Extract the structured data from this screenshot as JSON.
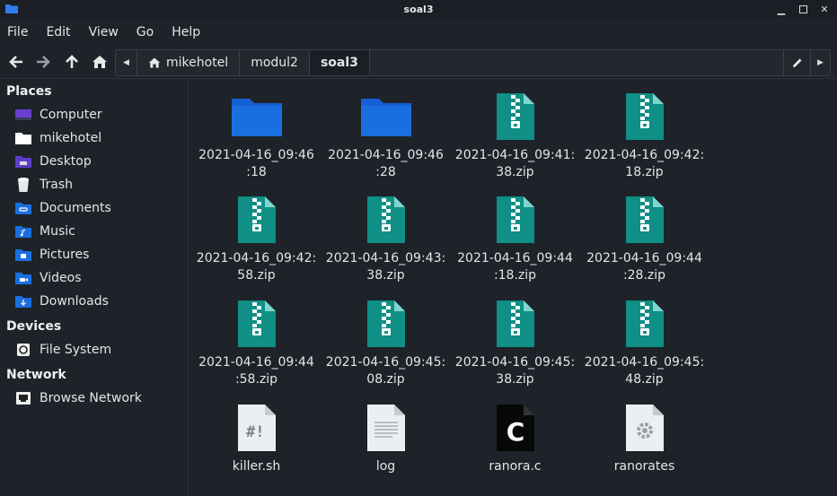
{
  "window": {
    "title": "soal3"
  },
  "menu": [
    "File",
    "Edit",
    "View",
    "Go",
    "Help"
  ],
  "breadcrumbs": [
    {
      "label": "mikehotel",
      "home": true
    },
    {
      "label": "modul2",
      "home": false
    },
    {
      "label": "soal3",
      "home": false
    }
  ],
  "sidebar": {
    "places_title": "Places",
    "places": [
      {
        "label": "Computer",
        "icon": "computer-icon"
      },
      {
        "label": "mikehotel",
        "icon": "home-folder-icon"
      },
      {
        "label": "Desktop",
        "icon": "desktop-icon"
      },
      {
        "label": "Trash",
        "icon": "trash-icon"
      },
      {
        "label": "Documents",
        "icon": "documents-icon"
      },
      {
        "label": "Music",
        "icon": "music-icon"
      },
      {
        "label": "Pictures",
        "icon": "pictures-icon"
      },
      {
        "label": "Videos",
        "icon": "videos-icon"
      },
      {
        "label": "Downloads",
        "icon": "downloads-icon"
      }
    ],
    "devices_title": "Devices",
    "devices": [
      {
        "label": "File System",
        "icon": "drive-icon"
      }
    ],
    "network_title": "Network",
    "network": [
      {
        "label": "Browse Network",
        "icon": "network-icon"
      }
    ]
  },
  "files": [
    {
      "line1": "2021-04-16_09:46",
      "line2": ":18",
      "type": "folder"
    },
    {
      "line1": "2021-04-16_09:46",
      "line2": ":28",
      "type": "folder"
    },
    {
      "line1": "2021-04-16_09:41:",
      "line2": "38.zip",
      "type": "zip"
    },
    {
      "line1": "2021-04-16_09:42:",
      "line2": "18.zip",
      "type": "zip"
    },
    {
      "line1": "2021-04-16_09:42:",
      "line2": "58.zip",
      "type": "zip"
    },
    {
      "line1": "2021-04-16_09:43:",
      "line2": "38.zip",
      "type": "zip"
    },
    {
      "line1": "2021-04-16_09:44",
      "line2": ":18.zip",
      "type": "zip"
    },
    {
      "line1": "2021-04-16_09:44",
      "line2": ":28.zip",
      "type": "zip"
    },
    {
      "line1": "2021-04-16_09:44",
      "line2": ":58.zip",
      "type": "zip"
    },
    {
      "line1": "2021-04-16_09:45:",
      "line2": "08.zip",
      "type": "zip"
    },
    {
      "line1": "2021-04-16_09:45:",
      "line2": "38.zip",
      "type": "zip"
    },
    {
      "line1": "2021-04-16_09:45:",
      "line2": "48.zip",
      "type": "zip"
    },
    {
      "line1": "killer.sh",
      "line2": "",
      "type": "script"
    },
    {
      "line1": "log",
      "line2": "",
      "type": "text"
    },
    {
      "line1": "ranora.c",
      "line2": "",
      "type": "c-source"
    },
    {
      "line1": "ranorates",
      "line2": "",
      "type": "executable"
    }
  ],
  "colors": {
    "folder": "#1a6fe0",
    "zip": "#0f8f86",
    "accent": "#3a86ff"
  }
}
